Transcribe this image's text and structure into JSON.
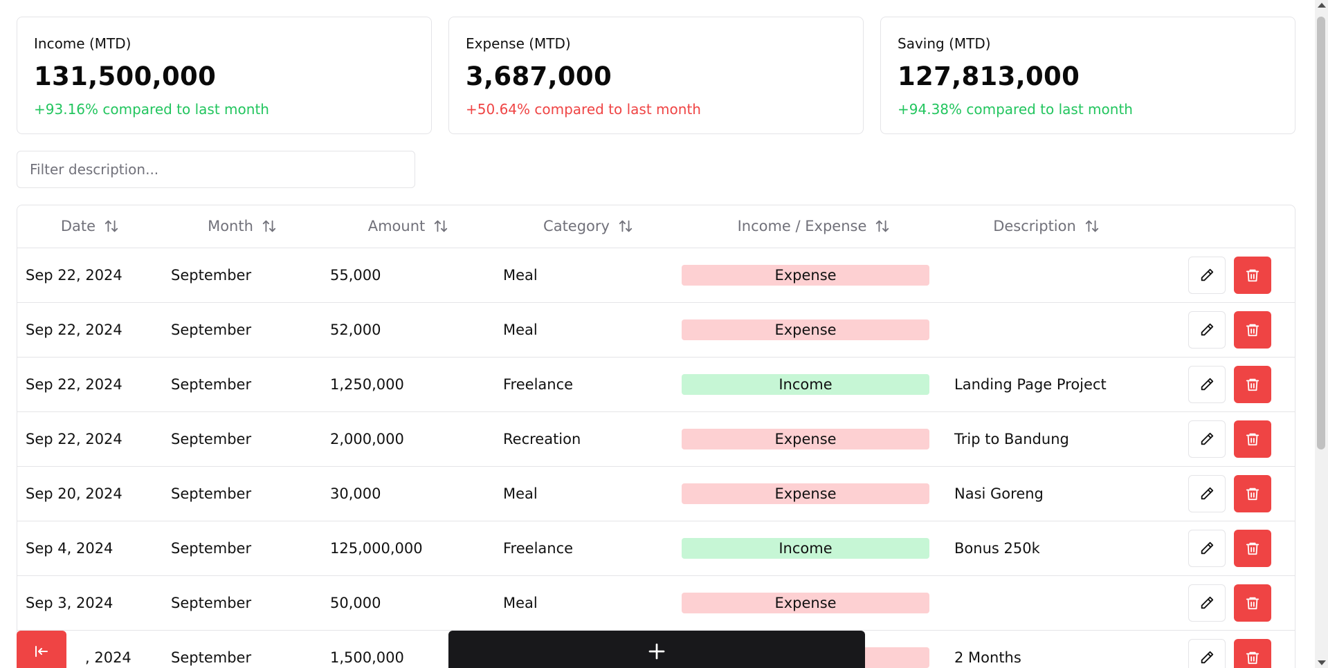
{
  "summary": {
    "income": {
      "label": "Income (MTD)",
      "value": "131,500,000",
      "delta": "+93.16% compared to last month"
    },
    "expense": {
      "label": "Expense (MTD)",
      "value": "3,687,000",
      "delta": "+50.64% compared to last month"
    },
    "saving": {
      "label": "Saving (MTD)",
      "value": "127,813,000",
      "delta": "+94.38% compared to last month"
    }
  },
  "filter": {
    "placeholder": "Filter description...",
    "value": ""
  },
  "table": {
    "headers": {
      "date": "Date",
      "month": "Month",
      "amount": "Amount",
      "category": "Category",
      "type": "Income / Expense",
      "description": "Description"
    },
    "rows": [
      {
        "date": "Sep 22, 2024",
        "month": "September",
        "amount": "55,000",
        "category": "Meal",
        "type": "Expense",
        "description": ""
      },
      {
        "date": "Sep 22, 2024",
        "month": "September",
        "amount": "52,000",
        "category": "Meal",
        "type": "Expense",
        "description": ""
      },
      {
        "date": "Sep 22, 2024",
        "month": "September",
        "amount": "1,250,000",
        "category": "Freelance",
        "type": "Income",
        "description": "Landing Page Project"
      },
      {
        "date": "Sep 22, 2024",
        "month": "September",
        "amount": "2,000,000",
        "category": "Recreation",
        "type": "Expense",
        "description": "Trip to Bandung"
      },
      {
        "date": "Sep 20, 2024",
        "month": "September",
        "amount": "30,000",
        "category": "Meal",
        "type": "Expense",
        "description": "Nasi Goreng"
      },
      {
        "date": "Sep 4, 2024",
        "month": "September",
        "amount": "125,000,000",
        "category": "Freelance",
        "type": "Income",
        "description": "Bonus 250k"
      },
      {
        "date": "Sep 3, 2024",
        "month": "September",
        "amount": "50,000",
        "category": "Meal",
        "type": "Expense",
        "description": ""
      },
      {
        "date": ", 2024",
        "month": "September",
        "amount": "1,500,000",
        "category": "",
        "type": "Expense",
        "description": "2 Months"
      }
    ]
  },
  "icons": {
    "sort": "sort-arrows-icon",
    "edit": "pencil-icon",
    "delete": "trash-icon",
    "exit": "exit-arrow-icon",
    "add": "plus-icon"
  },
  "colors": {
    "positive": "#22c55e",
    "negative": "#ef4444",
    "expense_pill": "#fdd0d2",
    "income_pill": "#c6f6d5",
    "add_button": "#18181b"
  }
}
